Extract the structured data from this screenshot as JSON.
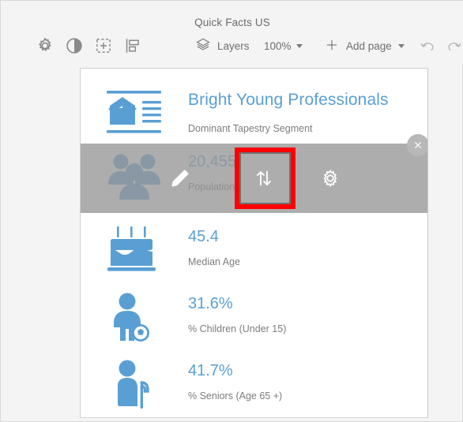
{
  "window": {
    "title": "Quick Facts US",
    "background": "#f4f4f4"
  },
  "toolbar": {
    "icons": [
      {
        "name": "settings-gear-icon",
        "label": "Settings"
      },
      {
        "name": "contrast-icon",
        "label": "Contrast"
      },
      {
        "name": "crop-add-icon",
        "label": "Add element"
      },
      {
        "name": "align-icon",
        "label": "Align"
      }
    ],
    "layers_label": "Layers",
    "layers_icon": "layers-stack-icon",
    "zoom_level": "100%",
    "add_page_label": "Add page",
    "add_page_icon": "plus-icon",
    "undo_icon": "undo-arrow-icon",
    "redo_icon": "redo-arrow-icon"
  },
  "card": {
    "header": {
      "icon": "house-document-icon",
      "title": "Bright Young Professionals",
      "subtitle": "Dominant Tapestry Segment",
      "title_color": "#5a9fd4"
    },
    "stats": [
      {
        "id": "population",
        "icon": "family-group-icon",
        "value": "20,455",
        "label": "Population"
      },
      {
        "id": "median-age",
        "icon": "birthday-cake-icon",
        "value": "45.4",
        "label": "Median Age"
      },
      {
        "id": "children",
        "icon": "child-with-ball-icon",
        "value": "31.6%",
        "label": "% Children (Under 15)"
      },
      {
        "id": "seniors",
        "icon": "senior-with-cane-icon",
        "value": "41.7%",
        "label": "% Seniors (Age 65 +)"
      }
    ]
  },
  "overlay": {
    "edit_icon": "pencil-edit-icon",
    "swap_icon": "swap-up-down-arrows-icon",
    "settings_icon": "gear-settings-icon",
    "close_icon": "close-x-icon",
    "highlight_color": "#fe0000",
    "highlighted_button": "swap-up-down-arrows-icon",
    "background_color": "#969696"
  }
}
